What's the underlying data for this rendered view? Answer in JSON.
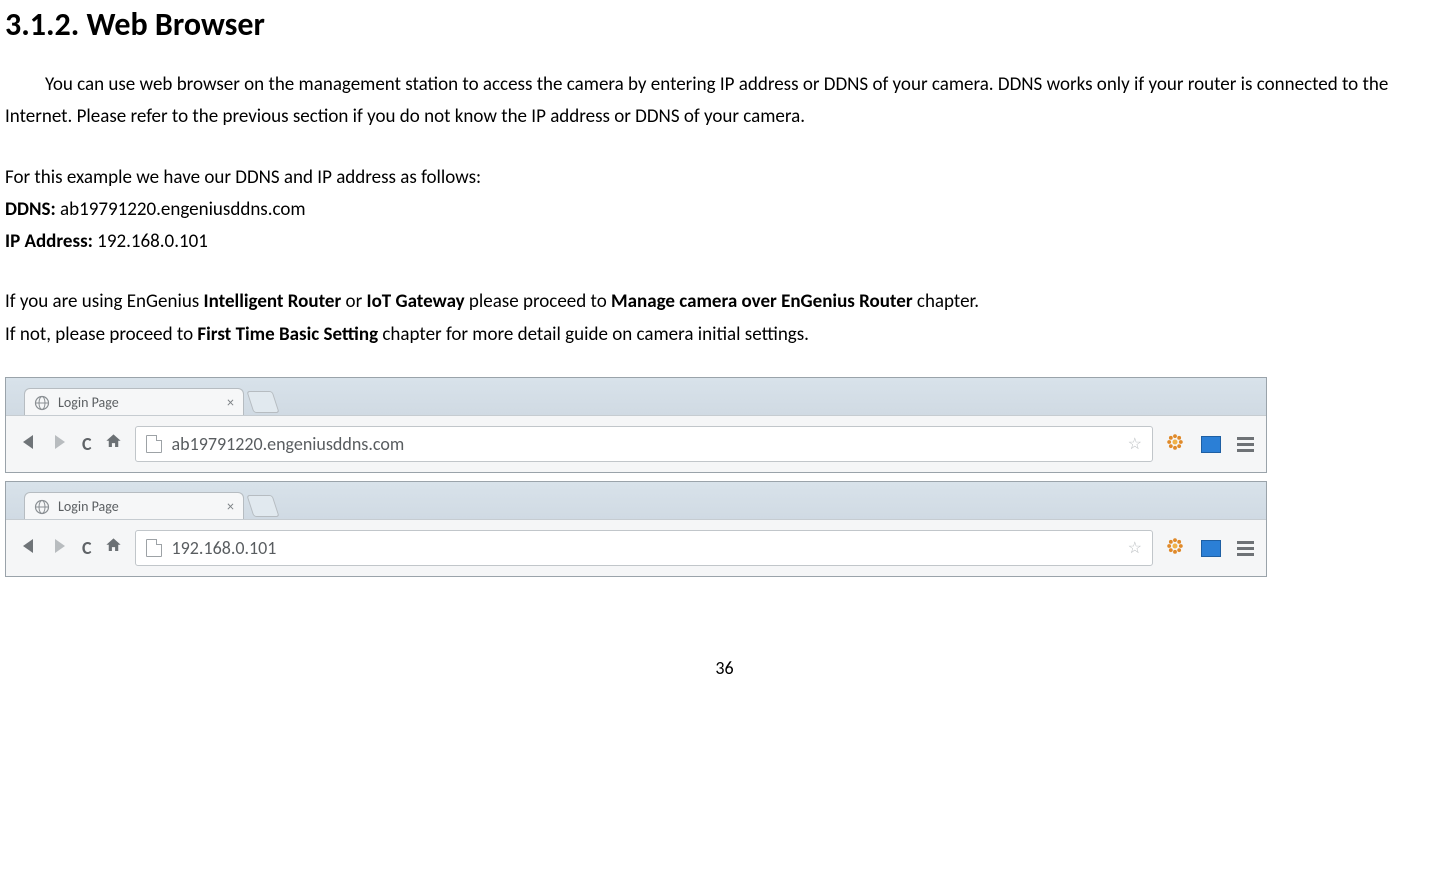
{
  "heading": "3.1.2.  Web Browser",
  "para1": "You can use web browser on the management station to access the camera by entering IP address or DDNS of your camera. DDNS works only if your router is connected to the Internet. Please refer to the previous section if you do not know the IP address or DDNS of your camera.",
  "para2": "For this example we have our DDNS and IP address as follows:",
  "ddns_label": "DDNS:",
  "ddns_value": " ab19791220.engeniusddns.com",
  "ip_label": "IP Address:",
  "ip_value": " 192.168.0.101",
  "para3a": "If you are using EnGenius ",
  "para3b_bold1": "Intelligent Router",
  "para3c": " or ",
  "para3d_bold2": "IoT Gateway",
  "para3e": " please proceed to ",
  "para3f_bold3": "Manage camera over EnGenius Router",
  "para3g": " chapter.",
  "para4a": "If not, please proceed to ",
  "para4b_bold": "First Time Basic Setting",
  "para4c": " chapter for more detail guide on camera initial settings.",
  "browser1": {
    "tab_title": "Login Page",
    "url": "ab19791220.engeniusddns.com"
  },
  "browser2": {
    "tab_title": "Login Page",
    "url": "192.168.0.101"
  },
  "page_number": "36"
}
